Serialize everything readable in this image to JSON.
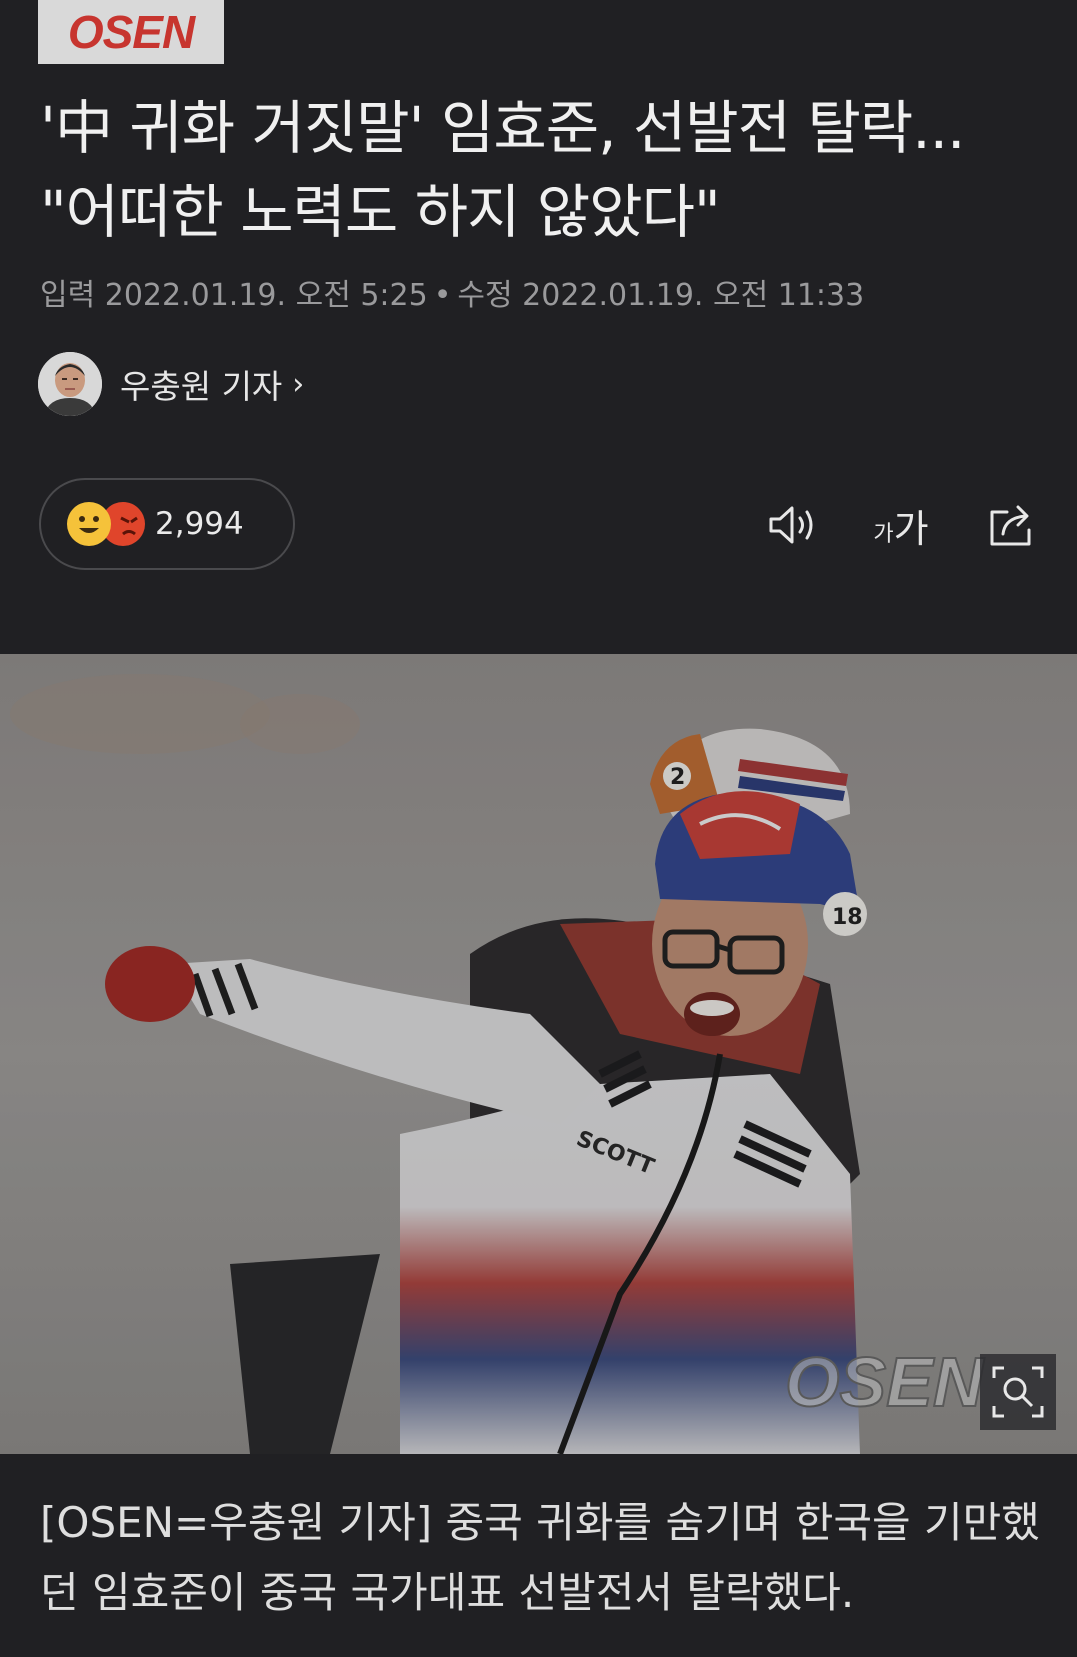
{
  "publisher": {
    "logo_text": "OSEN"
  },
  "headline": "'中 귀화 거짓말' 임효준, 선발전 탈락... \"어떠한 노력도 하지 않았다\"",
  "meta": {
    "published_label": "입력",
    "published_value": "2022.01.19. 오전 5:25",
    "separator": "•",
    "modified_label": "수정",
    "modified_value": "2022.01.19. 오전 11:33"
  },
  "author": {
    "name": "우충원 기자",
    "chevron": "›"
  },
  "reactions": {
    "count": "2,994"
  },
  "toolbar": {
    "text_size_small": "가",
    "text_size_large": "가"
  },
  "photo": {
    "watermark": "OSEN"
  },
  "caption": "[OSEN=우충원 기자] 중국 귀화를 숨기며 한국을 기만했던 임효준이 중국 국가대표 선발전서 탈락했다."
}
